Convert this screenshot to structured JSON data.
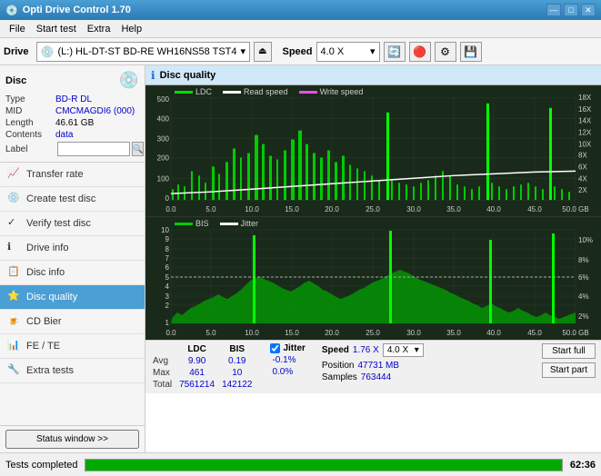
{
  "app": {
    "title": "Opti Drive Control 1.70",
    "icon": "💿"
  },
  "title_bar": {
    "title": "Opti Drive Control 1.70",
    "minimize": "—",
    "maximize": "□",
    "close": "✕"
  },
  "menu": {
    "items": [
      "File",
      "Start test",
      "Extra",
      "Help"
    ]
  },
  "toolbar": {
    "drive_label": "Drive",
    "drive_value": "(L:)  HL-DT-ST BD-RE  WH16NS58 TST4",
    "speed_label": "Speed",
    "speed_value": "4.0 X"
  },
  "sidebar": {
    "disc_section": {
      "title": "Disc",
      "type_label": "Type",
      "type_value": "BD-R DL",
      "mid_label": "MID",
      "mid_value": "CMCMAGDI6 (000)",
      "length_label": "Length",
      "length_value": "46.61 GB",
      "contents_label": "Contents",
      "contents_value": "data",
      "label_label": "Label",
      "label_value": ""
    },
    "nav_items": [
      {
        "id": "transfer-rate",
        "label": "Transfer rate",
        "icon": "📈"
      },
      {
        "id": "create-test-disc",
        "label": "Create test disc",
        "icon": "💿"
      },
      {
        "id": "verify-test-disc",
        "label": "Verify test disc",
        "icon": "✓"
      },
      {
        "id": "drive-info",
        "label": "Drive info",
        "icon": "ℹ"
      },
      {
        "id": "disc-info",
        "label": "Disc info",
        "icon": "📋"
      },
      {
        "id": "disc-quality",
        "label": "Disc quality",
        "icon": "⭐",
        "active": true
      },
      {
        "id": "cd-bier",
        "label": "CD Bier",
        "icon": "🍺"
      },
      {
        "id": "fe-te",
        "label": "FE / TE",
        "icon": "📊"
      },
      {
        "id": "extra-tests",
        "label": "Extra tests",
        "icon": "🔧"
      }
    ],
    "status_window": "Status window >>"
  },
  "disc_quality": {
    "title": "Disc quality",
    "legend_top": {
      "ldc": "LDC",
      "read_speed": "Read speed",
      "write_speed": "Write speed"
    },
    "legend_bottom": {
      "bis": "BIS",
      "jitter": "Jitter"
    },
    "top_chart": {
      "y_axis_left": [
        "500",
        "400",
        "300",
        "200",
        "100",
        "0"
      ],
      "y_axis_right": [
        "18X",
        "16X",
        "14X",
        "12X",
        "10X",
        "8X",
        "6X",
        "4X",
        "2X"
      ],
      "x_axis": [
        "0.0",
        "5.0",
        "10.0",
        "15.0",
        "20.0",
        "25.0",
        "30.0",
        "35.0",
        "40.0",
        "45.0",
        "50.0 GB"
      ]
    },
    "bottom_chart": {
      "y_axis_left": [
        "10",
        "9",
        "8",
        "7",
        "6",
        "5",
        "4",
        "3",
        "2",
        "1"
      ],
      "y_axis_right": [
        "10%",
        "8%",
        "6%",
        "4%",
        "2%"
      ],
      "x_axis": [
        "0.0",
        "5.0",
        "10.0",
        "15.0",
        "20.0",
        "25.0",
        "30.0",
        "35.0",
        "40.0",
        "45.0",
        "50.0 GB"
      ]
    },
    "stats": {
      "headers": [
        "",
        "LDC",
        "BIS",
        "",
        "Jitter",
        "Speed"
      ],
      "avg_label": "Avg",
      "avg_ldc": "9.90",
      "avg_bis": "0.19",
      "avg_jitter": "-0.1%",
      "max_label": "Max",
      "max_ldc": "461",
      "max_bis": "10",
      "max_jitter": "0.0%",
      "total_label": "Total",
      "total_ldc": "7561214",
      "total_bis": "142122",
      "speed_value": "1.76 X",
      "speed_select": "4.0 X",
      "position_label": "Position",
      "position_value": "47731 MB",
      "samples_label": "Samples",
      "samples_value": "763444",
      "jitter_checked": true,
      "start_full": "Start full",
      "start_part": "Start part"
    }
  },
  "status_bar": {
    "text": "Tests completed",
    "progress": 100,
    "time": "62:36"
  },
  "colors": {
    "ldc_color": "#00ff00",
    "read_speed_color": "#ffffff",
    "write_speed_color": "#ff00ff",
    "bis_color": "#00cc00",
    "jitter_color": "#ffffff",
    "chart_bg": "#1a2a1a",
    "grid_color": "#2a3a2a",
    "accent_blue": "#4a9fd4"
  }
}
